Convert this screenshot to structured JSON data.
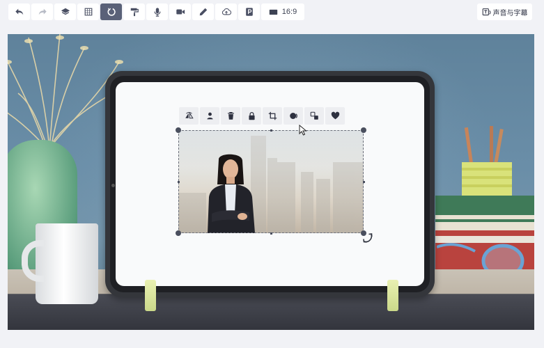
{
  "toolbar": {
    "buttons": [
      {
        "name": "undo-button",
        "icon": "undo-icon"
      },
      {
        "name": "redo-button",
        "icon": "redo-icon"
      },
      {
        "name": "layers-button",
        "icon": "layers-icon"
      },
      {
        "name": "grid-button",
        "icon": "grid-icon"
      },
      {
        "name": "magic-button",
        "icon": "magic-loop-icon",
        "active": true
      },
      {
        "name": "paint-button",
        "icon": "paint-roller-icon"
      },
      {
        "name": "record-audio-button",
        "icon": "microphone-icon"
      },
      {
        "name": "record-video-button",
        "icon": "video-camera-icon"
      },
      {
        "name": "draw-button",
        "icon": "pencil-icon"
      },
      {
        "name": "upload-button",
        "icon": "cloud-upload-icon"
      },
      {
        "name": "export-button",
        "icon": "p-badge-icon"
      }
    ],
    "aspect_ratio": "16:9",
    "tts_label": "声音与字幕"
  },
  "element_toolbar": {
    "icons": [
      "flip-icon",
      "replace-person-icon",
      "delete-icon",
      "lock-icon",
      "crop-icon",
      "mask-icon",
      "swap-icon",
      "favorite-icon"
    ]
  },
  "colors": {
    "toolbar_bg": "#ffffff",
    "active_button": "#5a6178",
    "page_bg": "#f1f2f6"
  }
}
